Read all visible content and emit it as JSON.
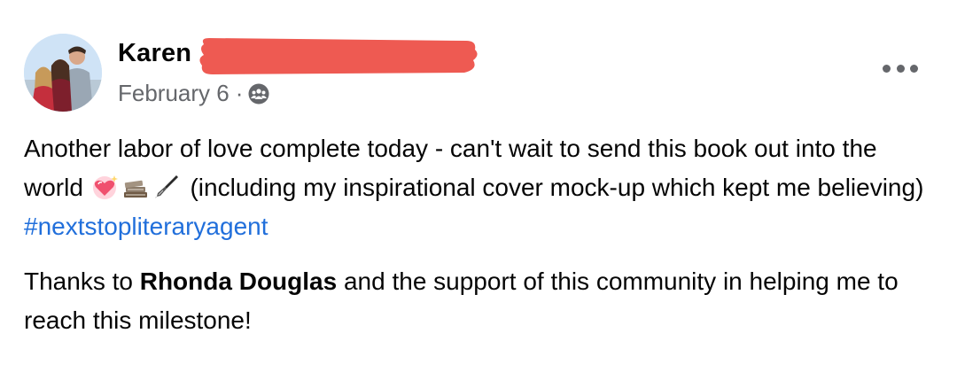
{
  "post": {
    "author_name": "Karen",
    "date": "February 6",
    "separator": "·",
    "audience_icon": "group-icon",
    "paragraph1": {
      "text_a": "Another labor of love complete today - can't wait to send this book out into the world ",
      "emojis": [
        "sparkling-heart",
        "books",
        "fountain-pen"
      ],
      "text_b": " (including my inspirational cover mock-up which kept me believing) ",
      "hashtag": "#nextstopliteraryagent"
    },
    "paragraph2": {
      "text_a": "Thanks to ",
      "mention": "Rhonda Douglas",
      "text_b": " and the support of this community in helping me to reach this milestone!"
    }
  },
  "colors": {
    "hashtag": "#216fdb",
    "meta": "#65676b",
    "redaction": "#ee5a52"
  }
}
